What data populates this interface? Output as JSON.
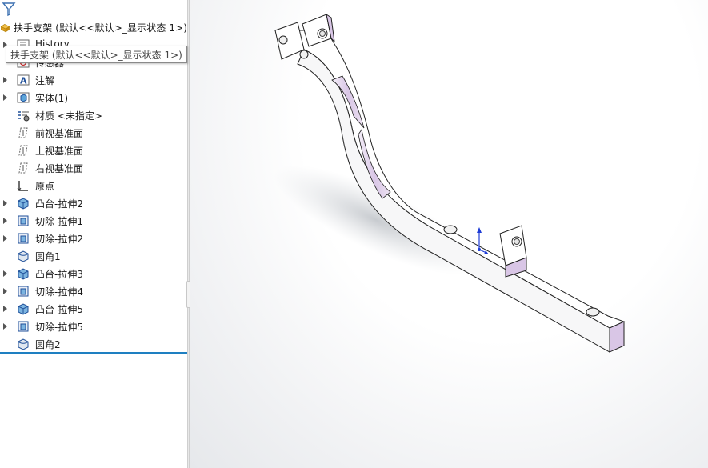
{
  "tree": {
    "root_label": "扶手支架 (默认<<默认>_显示状态 1>)",
    "tooltip": "扶手支架 (默认<<默认>_显示状态 1>)",
    "items": [
      {
        "label": "History",
        "icon": "history-icon",
        "expandable": true
      },
      {
        "label": "传感器",
        "icon": "sensor-icon",
        "expandable": false
      },
      {
        "label": "注解",
        "icon": "annotation-icon",
        "expandable": true
      },
      {
        "label": "实体(1)",
        "icon": "solid-body-icon",
        "expandable": true
      },
      {
        "label": "材质 <未指定>",
        "icon": "material-icon",
        "expandable": false
      },
      {
        "label": "前视基准面",
        "icon": "plane-icon",
        "expandable": false
      },
      {
        "label": "上视基准面",
        "icon": "plane-icon",
        "expandable": false
      },
      {
        "label": "右视基准面",
        "icon": "plane-icon",
        "expandable": false
      },
      {
        "label": "原点",
        "icon": "origin-icon",
        "expandable": false
      },
      {
        "label": "凸台-拉伸2",
        "icon": "boss-extrude-icon",
        "expandable": true
      },
      {
        "label": "切除-拉伸1",
        "icon": "cut-extrude-icon",
        "expandable": true
      },
      {
        "label": "切除-拉伸2",
        "icon": "cut-extrude-icon",
        "expandable": true
      },
      {
        "label": "圆角1",
        "icon": "fillet-icon",
        "expandable": false
      },
      {
        "label": "凸台-拉伸3",
        "icon": "boss-extrude-icon",
        "expandable": true
      },
      {
        "label": "切除-拉伸4",
        "icon": "cut-extrude-icon",
        "expandable": true
      },
      {
        "label": "凸台-拉伸5",
        "icon": "boss-extrude-icon",
        "expandable": true
      },
      {
        "label": "切除-拉伸5",
        "icon": "cut-extrude-icon",
        "expandable": true
      },
      {
        "label": "圆角2",
        "icon": "fillet-icon",
        "expandable": false
      }
    ]
  },
  "colors": {
    "accent": "#1e7fc1",
    "part_face": "#ffffff",
    "part_highlight": "#d9c6e6"
  }
}
